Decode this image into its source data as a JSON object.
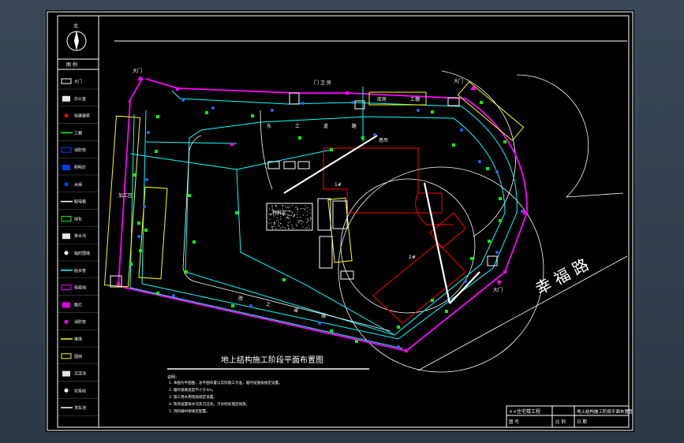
{
  "title": "地上结构施工阶段平面布置图",
  "north_label": "北",
  "road_name": "幸 福 路",
  "gate_labels": [
    "大门",
    "大门",
    "大门"
  ],
  "labels": {
    "east_road": "东 工 道 路",
    "west_road": "西 工 道 路",
    "site_office": "门 卫 房",
    "building_1": "1#",
    "building_2": "2#",
    "work_shed": "工棚",
    "material_area": "材料区",
    "storage": "库房",
    "processing": "加工区",
    "tower_crane": "塔吊"
  },
  "notes_title": "说明：",
  "notes": [
    "1. 本图为平面图，总平面布置以实际施工为准，临时设施按规定设置。",
    "2. 临时道路宽度不小于4m。",
    "3. 施工用水用电按规定设置。",
    "4. 现场设置排水沟及沉淀池，污水经处理后排放。",
    "5. 消防器材按规定配置。"
  ],
  "legend": [
    {
      "icon": "gate-icon",
      "label": "大门"
    },
    {
      "icon": "office-icon",
      "label": "办公室"
    },
    {
      "icon": "building-outline-icon",
      "label": "拟建建筑"
    },
    {
      "icon": "shed-icon",
      "label": "工棚"
    },
    {
      "icon": "hydrant-icon",
      "label": "消防栓"
    },
    {
      "icon": "light-icon",
      "label": "照明灯"
    },
    {
      "icon": "valve-icon",
      "label": "水阀"
    },
    {
      "icon": "box-icon",
      "label": "配电箱"
    },
    {
      "icon": "tree-icon",
      "label": "绿化"
    },
    {
      "icon": "drain-icon",
      "label": "排水沟"
    },
    {
      "icon": "line-icon",
      "label": "临时围墙"
    },
    {
      "icon": "water-line-icon",
      "label": "给水管"
    },
    {
      "icon": "power-line-icon",
      "label": "电缆线"
    },
    {
      "icon": "lamp-icon",
      "label": "路灯"
    },
    {
      "icon": "pipe-icon",
      "label": "消防管"
    },
    {
      "icon": "yard-icon",
      "label": "堆场"
    },
    {
      "icon": "fence-icon",
      "label": "围挡"
    },
    {
      "icon": "tank-icon",
      "label": "沉淀池"
    },
    {
      "icon": "dump-icon",
      "label": "垃圾站"
    },
    {
      "icon": "car-icon",
      "label": "洗车池"
    }
  ],
  "title_block": {
    "project": "××住宅楼工程",
    "drawing_name": "地上结构施工阶段平面布置图",
    "row2_left": "图 号",
    "row2_mid": "比 例",
    "row2_right": "日 期"
  },
  "colors": {
    "paper": "#000000",
    "frame": "#ffffff",
    "road": "#00ffff",
    "fence": "#ff00ff",
    "green": "#00ff00",
    "red": "#ff0000",
    "yellow": "#ffff00",
    "blue": "#0040ff"
  }
}
